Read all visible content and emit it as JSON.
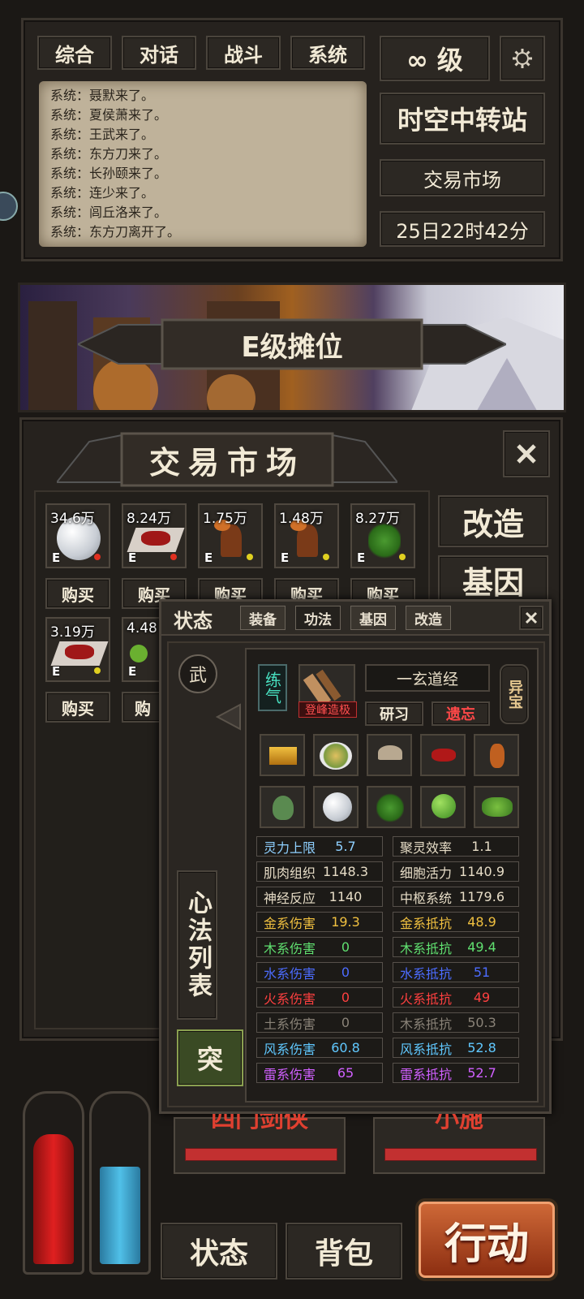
{
  "top": {
    "tabs": [
      "综合",
      "对话",
      "战斗",
      "系统"
    ],
    "level_label": "∞ 级",
    "location": "时空中转站",
    "sub_location": "交易市场",
    "time": "25日22时42分"
  },
  "chat": [
    "系统：聂默来了。",
    "系统：夏侯萧来了。",
    "系统：王武来了。",
    "系统：东方刀来了。",
    "系统：长孙颐来了。",
    "系统：连少来了。",
    "系统：闾丘洛来了。",
    "系统：东方刀离开了。"
  ],
  "banner": {
    "title": "E级摊位"
  },
  "market": {
    "title": "交易市场",
    "side_buttons": [
      "改造",
      "基因"
    ],
    "items_row1": [
      {
        "price": "34.6万",
        "grade": "E",
        "dot": "#e03020",
        "icon": "pearl"
      },
      {
        "price": "8.24万",
        "grade": "E",
        "dot": "#e03020",
        "icon": "red-powder"
      },
      {
        "price": "1.75万",
        "grade": "E",
        "dot": "#e0d020",
        "icon": "mushroom-tree"
      },
      {
        "price": "1.48万",
        "grade": "E",
        "dot": "#e0d020",
        "icon": "mushroom-tree"
      },
      {
        "price": "8.27万",
        "grade": "E",
        "dot": "#e0d020",
        "icon": "herb"
      }
    ],
    "items_row2": [
      {
        "price": "3.19万",
        "grade": "E",
        "dot": "#e0d020",
        "icon": "red-powder"
      },
      {
        "price": "4.48",
        "grade": "E",
        "dot": "#e0d020",
        "icon": "green-beans"
      }
    ],
    "buy_label": "购买",
    "buy_partial": "购"
  },
  "status_panel": {
    "title": "状态",
    "tabs": [
      "装备",
      "功法",
      "基因",
      "改造"
    ],
    "wu_label": "武",
    "list_label": "心法列表",
    "break_label": "突",
    "skill": {
      "type_label": "练气",
      "name": "一玄道经",
      "level": "登峰造极",
      "study": "研习",
      "forget": "遗忘",
      "treasure": "异宝"
    },
    "stats": [
      {
        "label": "灵力上限",
        "value": "5.7",
        "color": "#8fd0ff"
      },
      {
        "label": "聚灵效率",
        "value": "1.1",
        "color": "#e6dcc6"
      },
      {
        "label": "肌肉组织",
        "value": "1148.3",
        "color": "#e6dcc6"
      },
      {
        "label": "细胞活力",
        "value": "1140.9",
        "color": "#e6dcc6"
      },
      {
        "label": "神经反应",
        "value": "1140",
        "color": "#e6dcc6"
      },
      {
        "label": "中枢系统",
        "value": "1179.6",
        "color": "#e6dcc6"
      },
      {
        "label": "金系伤害",
        "value": "19.3",
        "color": "#f0c040"
      },
      {
        "label": "金系抵抗",
        "value": "48.9",
        "color": "#f0c040"
      },
      {
        "label": "木系伤害",
        "value": "0",
        "color": "#60e070"
      },
      {
        "label": "木系抵抗",
        "value": "49.4",
        "color": "#60e070"
      },
      {
        "label": "水系伤害",
        "value": "0",
        "color": "#4c6cff"
      },
      {
        "label": "水系抵抗",
        "value": "51",
        "color": "#4c6cff"
      },
      {
        "label": "火系伤害",
        "value": "0",
        "color": "#ff4040"
      },
      {
        "label": "火系抵抗",
        "value": "49",
        "color": "#ff4040"
      },
      {
        "label": "土系伤害",
        "value": "0",
        "color": "#8a8378"
      },
      {
        "label": "木系抵抗",
        "value": "50.3",
        "color": "#8a8378"
      },
      {
        "label": "风系伤害",
        "value": "60.8",
        "color": "#60c8ff"
      },
      {
        "label": "风系抵抗",
        "value": "52.8",
        "color": "#60c8ff"
      },
      {
        "label": "雷系伤害",
        "value": "65",
        "color": "#d060ff"
      },
      {
        "label": "雷系抵抗",
        "value": "52.7",
        "color": "#d060ff"
      }
    ]
  },
  "targets": [
    "四门剑侠",
    "小施"
  ],
  "bottom": {
    "status": "状态",
    "bag": "背包",
    "action": "行动"
  }
}
